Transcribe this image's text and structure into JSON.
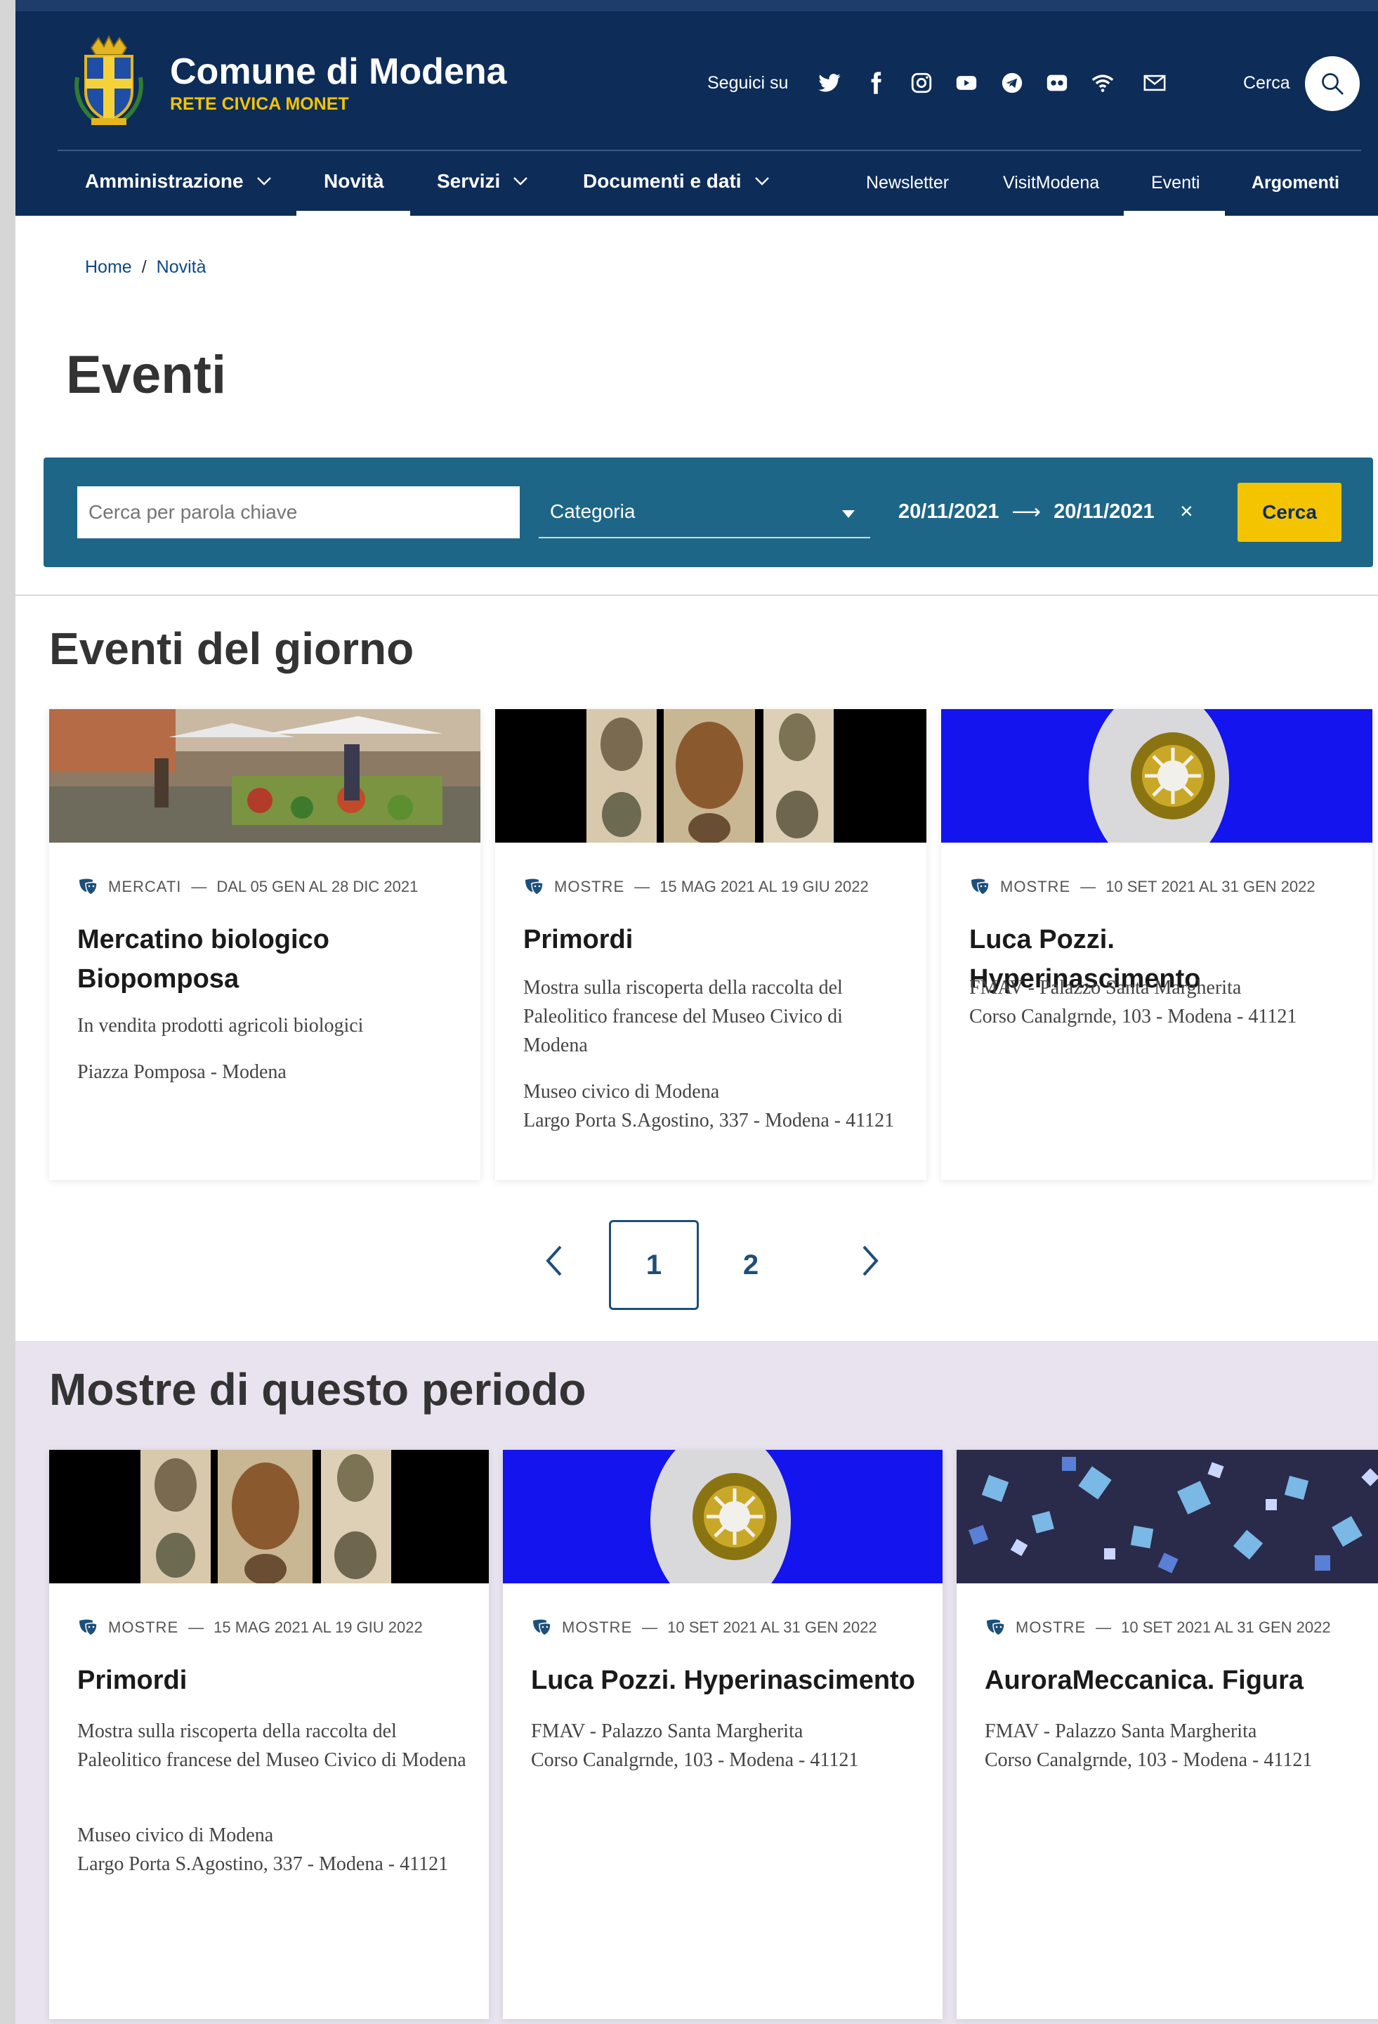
{
  "header": {
    "brand_title": "Comune di Modena",
    "brand_subtitle": "RETE CIVICA MONET",
    "follow_label": "Seguici su",
    "social_icons": [
      "twitter-icon",
      "facebook-icon",
      "instagram-icon",
      "youtube-icon",
      "telegram-icon",
      "flickr-icon",
      "rss-icon",
      "mail-icon"
    ],
    "search_label": "Cerca",
    "nav": [
      {
        "label": "Amministrazione",
        "dropdown": true
      },
      {
        "label": "Novità",
        "dropdown": false,
        "active": true
      },
      {
        "label": "Servizi",
        "dropdown": true
      },
      {
        "label": "Documenti e dati",
        "dropdown": true
      }
    ],
    "secondary_nav": [
      {
        "label": "Newsletter"
      },
      {
        "label": "VisitModena"
      },
      {
        "label": "Eventi",
        "active": true
      },
      {
        "label": "Argomenti"
      }
    ],
    "colors": {
      "header_bg": "#0d2c58",
      "accent": "#f5c400"
    }
  },
  "breadcrumb": {
    "home": "Home",
    "separator": "/",
    "current": "Novità"
  },
  "page_title": "Eventi",
  "filter": {
    "keyword_placeholder": "Cerca per parola chiave",
    "category_label": "Categoria",
    "date_from": "20/11/2021",
    "date_to": "20/11/2021",
    "date_arrow": "⟶",
    "clear_symbol": "×",
    "search_button": "Cerca",
    "bar_color": "#1e6688"
  },
  "events_section": {
    "title": "Eventi del giorno",
    "cards": [
      {
        "category": "MERCATI",
        "dash": "—",
        "dates": "DAL 05 GEN AL 28 DIC 2021",
        "title": "Mercatino biologico Biopomposa",
        "description": "In vendita prodotti agricoli biologici",
        "location": "Piazza Pomposa - Modena"
      },
      {
        "category": "MOSTRE",
        "dash": "—",
        "dates": "15 MAG 2021 AL 19 GIU 2022",
        "title": "Primordi",
        "description": "Mostra sulla riscoperta della raccolta del Paleolitico francese del Museo Civico di Modena",
        "location_line1": "Museo civico di Modena",
        "location_line2": "Largo Porta S.Agostino, 337 - Modena - 41121"
      },
      {
        "category": "MOSTRE",
        "dash": "—",
        "dates": "10 SET 2021 AL 31 GEN 2022",
        "title": "Luca Pozzi. Hyperinascimento",
        "location_line1": "FMAV - Palazzo Santa Margherita",
        "location_line2": "Corso Canalgrnde, 103 - Modena - 41121"
      }
    ]
  },
  "pagination": {
    "prev_icon": "chevron-left-icon",
    "pages": [
      "1",
      "2"
    ],
    "current": "1",
    "next_icon": "chevron-right-icon"
  },
  "exhibitions_section": {
    "title": "Mostre di questo periodo",
    "cards": [
      {
        "category": "MOSTRE",
        "dash": "—",
        "dates": "15 MAG 2021 AL 19 GIU 2022",
        "title": "Primordi",
        "description": "Mostra sulla riscoperta della raccolta del Paleolitico francese del Museo Civico di Modena",
        "location_line1": "Museo civico di Modena",
        "location_line2": "Largo Porta S.Agostino, 337 - Modena - 41121"
      },
      {
        "category": "MOSTRE",
        "dash": "—",
        "dates": "10 SET 2021 AL 31 GEN 2022",
        "title": "Luca Pozzi. Hyperinascimento",
        "location_line1": "FMAV - Palazzo Santa Margherita",
        "location_line2": "Corso Canalgrnde, 103 - Modena - 41121"
      },
      {
        "category": "MOSTRE",
        "dash": "—",
        "dates": "10 SET 2021 AL 31 GEN 2022",
        "title": "AuroraMeccanica. Figura",
        "location_line1": "FMAV - Palazzo Santa Margherita",
        "location_line2": "Corso Canalgrnde, 103 - Modena - 41121"
      }
    ]
  }
}
